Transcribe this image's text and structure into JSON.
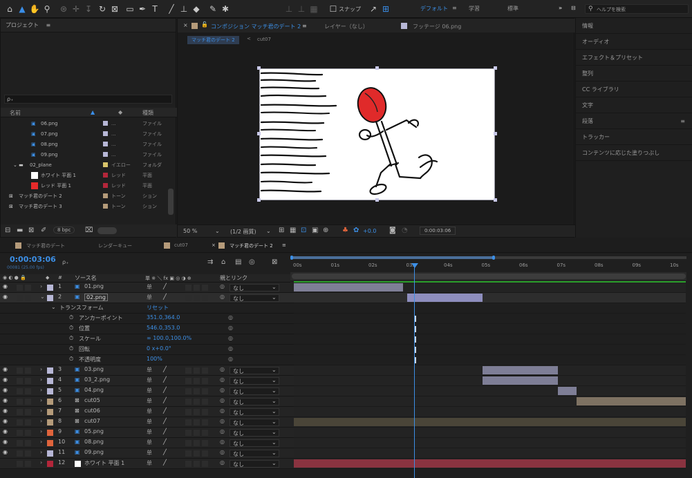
{
  "toolbar": {
    "snapping_label": "スナップ",
    "workspaces": [
      "デフォルト",
      "学習",
      "標準"
    ],
    "search_placeholder": "ヘルプを検索"
  },
  "project": {
    "title": "プロジェクト",
    "search_placeholder": "ρ₊",
    "columns": {
      "name": "名前",
      "type": "種類"
    },
    "items": [
      {
        "name": "06.png",
        "label": "...",
        "type": "ファイル",
        "color": "#b7b7d6"
      },
      {
        "name": "07.png",
        "label": "...",
        "type": "ファイル",
        "color": "#b7b7d6"
      },
      {
        "name": "08.png",
        "label": "...",
        "type": "ファイル",
        "color": "#b7b7d6"
      },
      {
        "name": "09.png",
        "label": "...",
        "type": "ファイル",
        "color": "#b7b7d6"
      },
      {
        "name": "02_plane",
        "label": "イエロー",
        "type": "フォルダ",
        "color": "#d9c46b"
      },
      {
        "name": "ホワイト 平面 1",
        "label": "レッド",
        "type": "平面",
        "color": "#b3263a"
      },
      {
        "name": "レッド 平面 1",
        "label": "レッド",
        "type": "平面",
        "color": "#b3263a"
      },
      {
        "name": "マッチ君のデート 2",
        "label": "トーン",
        "type": "ション",
        "color": "#b59b7a"
      },
      {
        "name": "マッチ君のデート 3",
        "label": "トーン",
        "type": "ション",
        "color": "#b59b7a"
      }
    ],
    "bpc": "8 bpc"
  },
  "composition": {
    "tab_label": "コンポジション マッチ君のデート 2",
    "layer_tab": "レイヤー（なし）",
    "footage_tab": "フッテージ 06.png",
    "breadcrumb": [
      "マッチ君のデート 2",
      "cut07"
    ],
    "zoom": "50 %",
    "resolution": "(1/2 画質)",
    "exposure": "+0.0",
    "timecode": "0:00:03:06"
  },
  "right_panel": {
    "items": [
      "情報",
      "オーディオ",
      "エフェクト＆プリセット",
      "整列",
      "CC ライブラリ",
      "文字",
      "段落",
      "トラッカー",
      "コンテンツに応じた塗りつぶし"
    ]
  },
  "timeline": {
    "tabs": [
      {
        "label": "マッチ君のデート",
        "color": "#b59b7a"
      },
      {
        "label": "レンダーキュー",
        "color": ""
      },
      {
        "label": "cut07",
        "color": "#b59b7a"
      },
      {
        "label": "マッチ君のデート 2",
        "color": "#b59b7a"
      }
    ],
    "timecode": "0:00:03:06",
    "frame_info": "00081 (25.00 fps)",
    "search_placeholder": "ρ₊",
    "columns": {
      "source": "ソース名",
      "switches": "単 ※ ＼ fx ▣ ◎ ◑ ⊕",
      "parent": "親とリンク"
    },
    "ruler": [
      "00s",
      "01s",
      "02s",
      "03s",
      "04s",
      "05s",
      "06s",
      "07s",
      "08s",
      "09s",
      "10s"
    ],
    "layers": [
      {
        "num": "1",
        "name": "01.png",
        "color": "#b7b7d6",
        "parent": "なし"
      },
      {
        "num": "2",
        "name": "02.png",
        "color": "#b7b7d6",
        "parent": "なし"
      },
      {
        "num": "3",
        "name": "03.png",
        "color": "#b7b7d6",
        "parent": "なし"
      },
      {
        "num": "4",
        "name": "03_2.png",
        "color": "#b7b7d6",
        "parent": "なし"
      },
      {
        "num": "5",
        "name": "04.png",
        "color": "#b7b7d6",
        "parent": "なし"
      },
      {
        "num": "6",
        "name": "cut05",
        "color": "#b59b7a",
        "parent": "なし"
      },
      {
        "num": "7",
        "name": "cut06",
        "color": "#b59b7a",
        "parent": "なし"
      },
      {
        "num": "8",
        "name": "cut07",
        "color": "#b59b7a",
        "parent": "なし"
      },
      {
        "num": "9",
        "name": "05.png",
        "color": "#e0643c",
        "parent": "なし"
      },
      {
        "num": "10",
        "name": "08.png",
        "color": "#e0643c",
        "parent": "なし"
      },
      {
        "num": "11",
        "name": "09.png",
        "color": "#b7b7d6",
        "parent": "なし"
      },
      {
        "num": "12",
        "name": "ホワイト 平面 1",
        "color": "#b3263a",
        "parent": "なし"
      }
    ],
    "transform": {
      "label": "トランスフォーム",
      "reset": "リセット",
      "props": [
        {
          "name": "アンカーポイント",
          "value": "351.0,364.0"
        },
        {
          "name": "位置",
          "value": "546.0,353.0"
        },
        {
          "name": "スケール",
          "value": "∞ 100.0,100.0%"
        },
        {
          "name": "回転",
          "value": "0 x+0.0°"
        },
        {
          "name": "不透明度",
          "value": "100%"
        }
      ]
    }
  }
}
